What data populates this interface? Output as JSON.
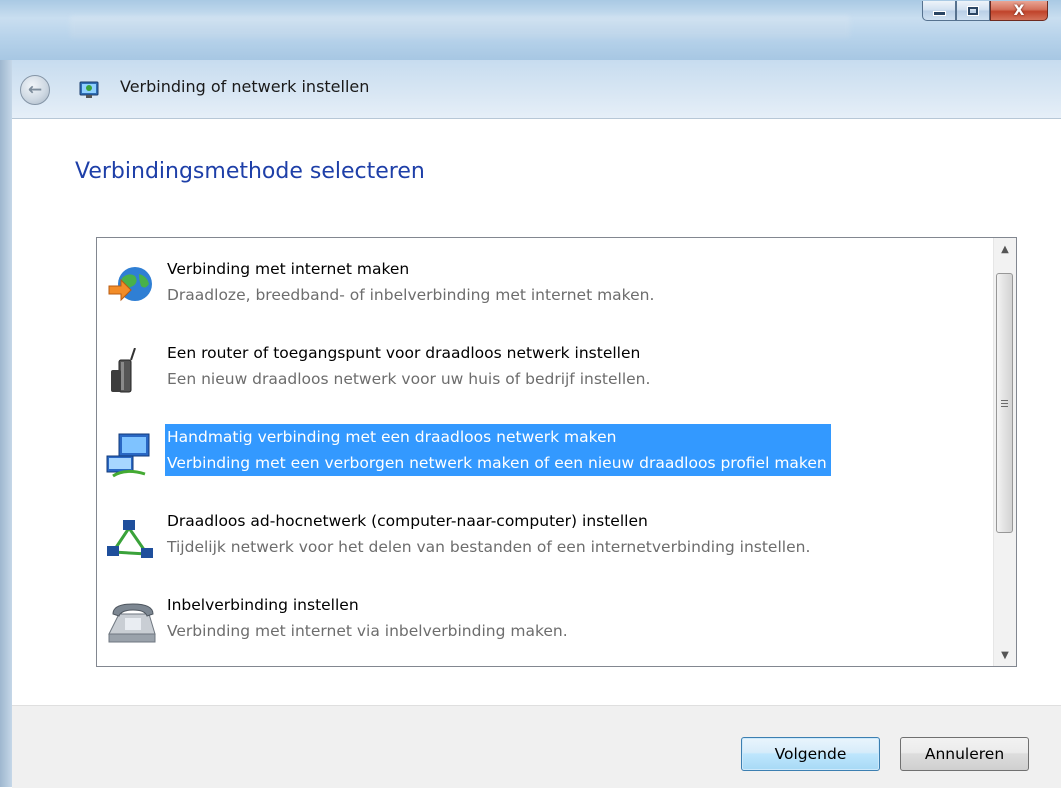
{
  "window": {
    "title": "Verbinding of netwerk instellen",
    "close_glyph": "X"
  },
  "navigation": {
    "back_glyph": "←"
  },
  "page": {
    "heading": "Verbindingsmethode selecteren"
  },
  "options": [
    {
      "icon": "globe-connect-icon",
      "title": "Verbinding met internet maken",
      "description": "Draadloze, breedband- of inbelverbinding met internet maken.",
      "selected": false
    },
    {
      "icon": "router-icon",
      "title": "Een router of toegangspunt voor draadloos netwerk instellen",
      "description": "Een nieuw draadloos netwerk voor uw huis of bedrijf instellen.",
      "selected": false
    },
    {
      "icon": "wireless-computer-icon",
      "title": "Handmatig verbinding met een draadloos netwerk maken",
      "description": "Verbinding met een verborgen netwerk maken of een nieuw draadloos profiel maken",
      "selected": true
    },
    {
      "icon": "adhoc-network-icon",
      "title": "Draadloos ad-hocnetwerk (computer-naar-computer) instellen",
      "description": "Tijdelijk netwerk voor het delen van bestanden of een internetverbinding instellen.",
      "selected": false
    },
    {
      "icon": "dialup-phone-icon",
      "title": "Inbelverbinding instellen",
      "description": "Verbinding met internet via inbelverbinding maken.",
      "selected": false
    }
  ],
  "buttons": {
    "next": "Volgende",
    "cancel": "Annuleren"
  },
  "colors": {
    "heading": "#1e3fa8",
    "selection": "#3399ff"
  }
}
